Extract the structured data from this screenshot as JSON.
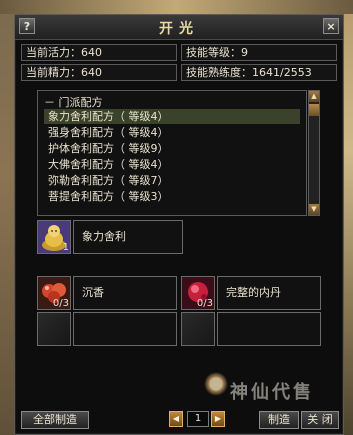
{
  "window": {
    "title": "开光",
    "help_label": "?",
    "close_label": "×"
  },
  "stats": {
    "vitality": "当前活力：640",
    "energy": "当前精力：640",
    "skill_level": "技能等级：9",
    "proficiency": "技能熟练度：1641/2553"
  },
  "recipes": {
    "header": "－ 门派配方",
    "items": [
      {
        "label": "象力舍利配方（ 等级4）"
      },
      {
        "label": "强身舍利配方（ 等级4）"
      },
      {
        "label": "护体舍利配方（ 等级9）"
      },
      {
        "label": "大佛舍利配方（ 等级4）"
      },
      {
        "label": "弥勒舍利配方（ 等级7）"
      },
      {
        "label": "菩提舍利配方（ 等级3）"
      }
    ],
    "selected_index": 0
  },
  "product": {
    "name": "象力舍利",
    "count": "1",
    "icon": "golden-buddha-icon"
  },
  "materials": [
    {
      "name": "沉香",
      "count": "0/3",
      "icon": "agarwood-icon"
    },
    {
      "name": "完整的内丹",
      "count": "0/3",
      "icon": "inner-pill-icon"
    }
  ],
  "footer": {
    "make_all_label": "全部制造",
    "page_value": "1",
    "make_label": "制造",
    "close_label": "关 闭",
    "watermark": "神仙代售"
  },
  "colors": {
    "accent_gold": "#e8d9a6",
    "selected_row": "#3a432a",
    "page_arrow": "#c08a3c"
  }
}
